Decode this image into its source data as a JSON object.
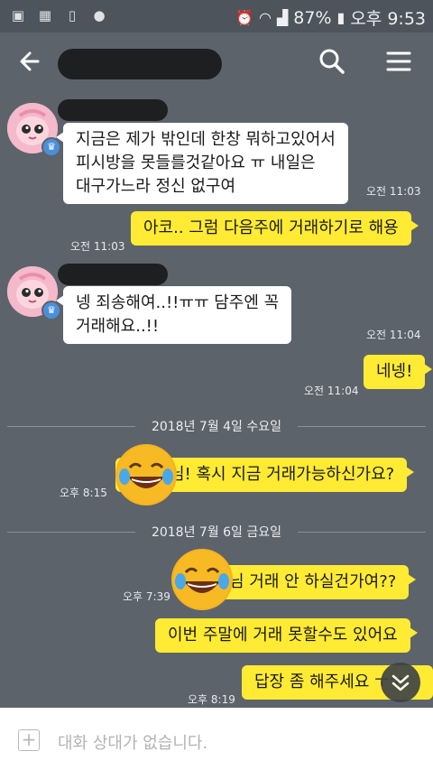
{
  "status_bar": {
    "battery": "87%",
    "time": "오후 9:53",
    "left_icons": [
      "image-icon",
      "gallery-icon",
      "phone-icon",
      "settings-icon"
    ],
    "right_icons": [
      "alarm-icon",
      "wifi-icon",
      "signal-icon",
      "battery-icon"
    ]
  },
  "header": {
    "back_icon": "arrow-left-icon",
    "search_icon": "search-icon",
    "menu_icon": "hamburger-menu-icon"
  },
  "messages": [
    {
      "side": "in",
      "text_lines": [
        "지금은 제가 밖인데 한창 뭐하고있어서",
        "피시방을 못들를것같아요 ㅠ 내일은",
        "대구가느라 정신 없구여"
      ],
      "time": "오전 11:03"
    },
    {
      "side": "out",
      "text": "아코.. 그럼 다음주에 거래하기로 해용",
      "time": "오전 11:03"
    },
    {
      "side": "in",
      "text_lines": [
        "넹 죄송해여..!!ㅠㅠ 담주엔 꼭",
        "거래해요..!!"
      ],
      "time": "오전 11:04"
    },
    {
      "side": "out",
      "text": "네넹!",
      "time": "오전 11:04"
    },
    {
      "side": "out",
      "text": "님! 혹시 지금 거래가능하신가요?",
      "time": "오후 8:15"
    },
    {
      "side": "out",
      "text": "님 거래 안 하실건가여??",
      "time": "오후 7:39"
    },
    {
      "side": "out",
      "text": "이번 주말에 거래 못할수도 있어요",
      "time": ""
    },
    {
      "side": "out",
      "text": "답장 좀 해주세요 ㅜㅜ",
      "time": "오후 8:19"
    }
  ],
  "dividers": [
    "2018년 7월 4일 수요일",
    "2018년 7월 6일 금요일"
  ],
  "input_bar": {
    "placeholder": "대화 상대가 없습니다.",
    "add_icon": "plus-square-icon"
  },
  "colors": {
    "chat_background": "#5d636b",
    "outgoing_bubble": "#ffeb33",
    "incoming_bubble": "#ffffff"
  }
}
